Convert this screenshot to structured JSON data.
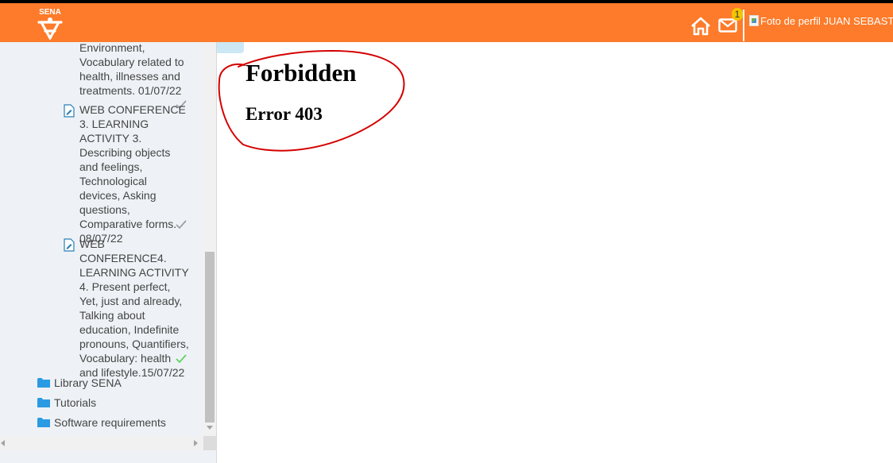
{
  "header": {
    "logo_text": "SENA",
    "notification_count": "1",
    "profile_alt": "Foto de perfil JUAN SEBASTIAN"
  },
  "sidebar": {
    "activities": [
      {
        "text": "Environment, Vocabulary related to health, illnesses and treatments. 01/07/22",
        "done": true
      },
      {
        "text": "WEB CONFERENCE 3. LEARNING ACTIVITY 3. Describing objects and feelings, Technological devices, Asking questions, Comparative forms. 08/07/22",
        "done": true
      },
      {
        "text": "WEB CONFERENCE4. LEARNING ACTIVITY 4. Present perfect, Yet, just and already, Talking about education, Indefinite pronouns, Quantifiers, Vocabulary: health and lifestyle.15/07/22",
        "done": true
      }
    ],
    "folders": [
      {
        "label": "Library SENA"
      },
      {
        "label": "Tutorials"
      },
      {
        "label": "Software requirements"
      }
    ]
  },
  "main": {
    "title": "Forbidden",
    "code": "Error 403"
  },
  "colors": {
    "header_bg": "#fd7b2a",
    "sidebar_bg": "#eef2f6",
    "check_done": "#5fd35f",
    "check_pending": "#9aa0a6",
    "annotation": "#d40000"
  }
}
